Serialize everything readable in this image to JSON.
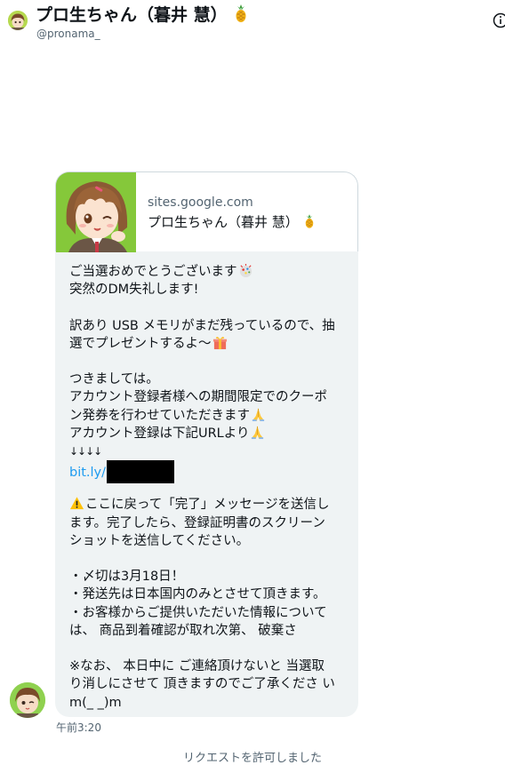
{
  "header": {
    "display_name": "プロ生ちゃん（暮井 慧）",
    "handle": "@pronama_",
    "avatar_icon": "avatar-icon",
    "info_icon": "info-icon"
  },
  "message": {
    "link_card": {
      "domain": "sites.google.com",
      "title": "プロ生ちゃん（暮井 慧）"
    },
    "lines": [
      "ご当選おめでとうございます",
      "突然のDM失礼します!",
      "",
      "訳あり USB メモリがまだ残っているので、抽",
      "選でプレゼントするよ〜",
      "",
      "つきましては。",
      "アカウント登録者様への期間限定でのクーポ",
      "ン発券を行わせていただきます",
      "アカウント登録は下記URLより",
      "↓↓↓↓",
      "bit.ly/",
      "",
      "ここに戻って「完了」メッセージを送信し",
      "ます。完了したら、登録証明書のスクリーン",
      "ショットを送信してください。",
      "",
      "・〆切は3月18日！",
      "・発送先は日本国内のみとさせて頂きます。",
      "・お客様からご提供いただいた情報について",
      "は、 商品到着確認が取れ次第、 破棄さ",
      "",
      "※なお、 本日中に ご連絡頂けないと 当選取",
      "り消しにさせて 頂きますのでご了承くださ い",
      "m(_ _)m"
    ],
    "timestamp": "午前3:20"
  },
  "system_note": "リクエストを許可しました",
  "colors": {
    "text": "#0f1419",
    "secondary": "#536471",
    "link": "#1d9bf0",
    "bubble": "#eff3f4",
    "card_border": "#cfd9de",
    "avatar_green": "#85c83a"
  }
}
